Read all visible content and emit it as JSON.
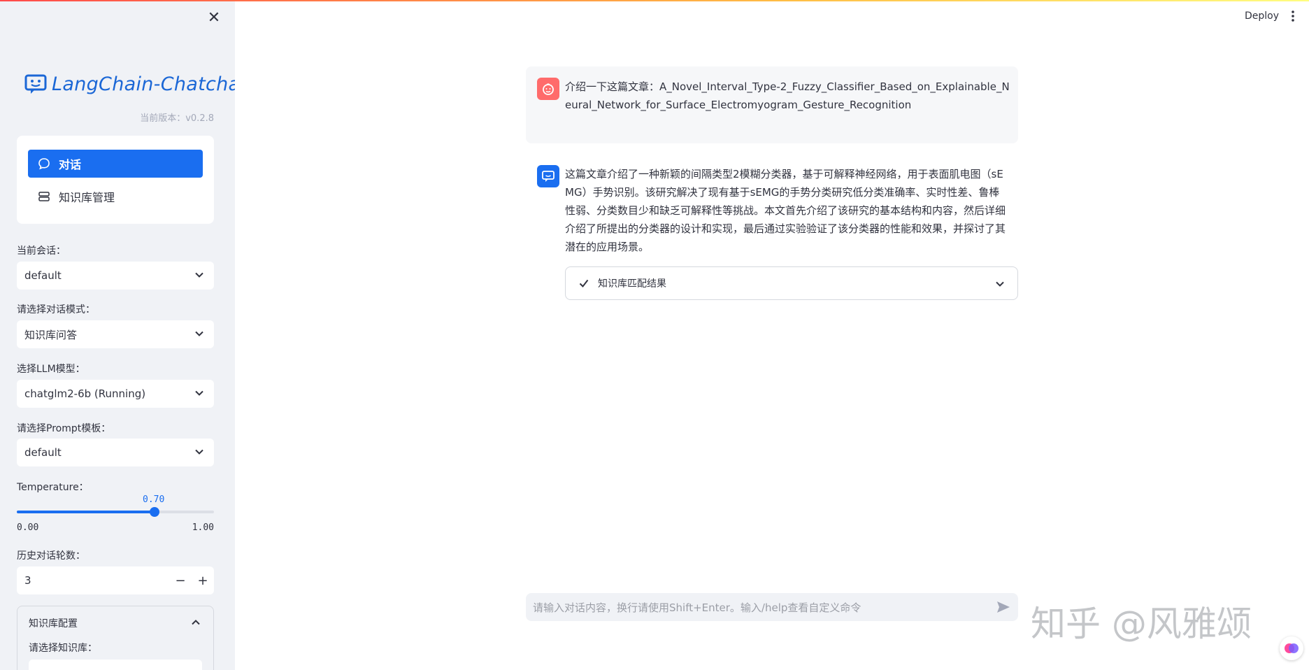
{
  "app": {
    "logo_text": "LangChain-Chatchat",
    "version": "当前版本：v0.2.8",
    "deploy_label": "Deploy",
    "close_icon": "✕",
    "accent_color": "#1a6ef0"
  },
  "sidebar": {
    "nav": [
      {
        "label": "对话",
        "icon": "chat-bubble-icon",
        "active": true
      },
      {
        "label": "知识库管理",
        "icon": "database-icon",
        "active": false
      }
    ],
    "conversation": {
      "label": "当前会话：",
      "value": "default"
    },
    "dialog_mode": {
      "label": "请选择对话模式：",
      "value": "知识库问答"
    },
    "llm_model": {
      "label": "选择LLM模型：",
      "value": "chatglm2-6b (Running)"
    },
    "prompt_template": {
      "label": "请选择Prompt模板：",
      "value": "default"
    },
    "temperature": {
      "label": "Temperature：",
      "value": 0.7,
      "value_text": "0.70",
      "min": "0.00",
      "max": "1.00"
    },
    "history_turns": {
      "label": "历史对话轮数：",
      "value": "3",
      "minus": "−",
      "plus": "+"
    },
    "kb_config": {
      "header": "知识库配置",
      "select_label": "请选择知识库："
    }
  },
  "chat": {
    "user_message": "介绍一下这篇文章：A_Novel_Interval_Type-2_Fuzzy_Classifier_Based_on_Explainable_Neural_Network_for_Surface_Electromyogram_Gesture_Recognition",
    "bot_message": "这篇文章介绍了一种新颖的间隔类型2模糊分类器，基于可解释神经网络，用于表面肌电图（sEMG）手势识别。该研究解决了现有基于sEMG的手势分类研究低分类准确率、实时性差、鲁棒性弱、分类数目少和缺乏可解释性等挑战。本文首先介绍了该研究的基本结构和内容，然后详细介绍了所提出的分类器的设计和实现，最后通过实验验证了该分类器的性能和效果，并探讨了其潜在的应用场景。",
    "kb_result_label": "知识库匹配结果",
    "input_placeholder": "请输入对话内容，换行请使用Shift+Enter。输入/help查看自定义命令"
  },
  "watermark": "知乎 @风雅颂"
}
